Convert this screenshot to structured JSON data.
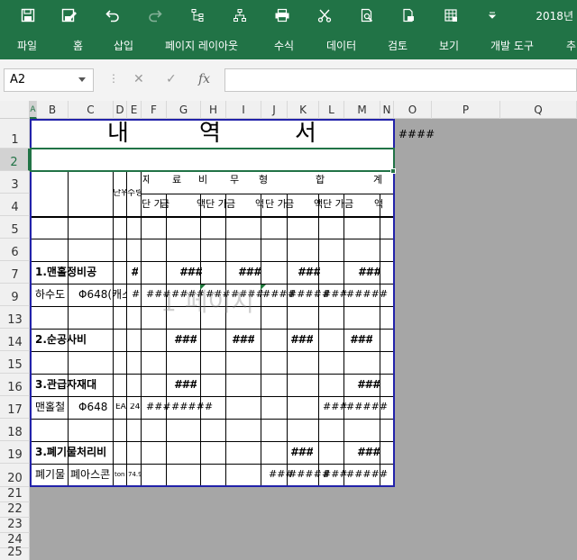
{
  "app": {
    "document_title": "2018년"
  },
  "qat": {
    "items": [
      "save-icon",
      "save-as-icon",
      "undo-icon",
      "redo-icon",
      "org-chart-icon",
      "hierarchy-icon",
      "print-icon",
      "scissors-icon",
      "print-preview-icon",
      "document-export-icon",
      "page-setup-icon",
      "customize-dropdown-icon"
    ]
  },
  "ribbon": {
    "tabs": [
      "파일",
      "홈",
      "삽입",
      "페이지 레이아웃",
      "수식",
      "데이터",
      "검토",
      "보기",
      "개발 도구",
      "추"
    ]
  },
  "formula_bar": {
    "name_box": "A2",
    "cancel": "✕",
    "enter": "✓",
    "fx": "fx",
    "content": ""
  },
  "columns": [
    "A",
    "B",
    "C",
    "D",
    "E",
    "F",
    "G",
    "H",
    "I",
    "J",
    "K",
    "L",
    "M",
    "N",
    "O",
    "P",
    "Q"
  ],
  "rows": [
    "1",
    "2",
    "3",
    "4",
    "5",
    "6",
    "7",
    "9",
    "13",
    "14",
    "15",
    "16",
    "17",
    "18",
    "19",
    "20",
    "21",
    "22",
    "23",
    "24",
    "25"
  ],
  "sheet": {
    "title_chars": [
      "내",
      "역",
      "서"
    ],
    "overflow_o1": "####",
    "header3": {
      "unit": "단위",
      "qty": "수량",
      "chars": [
        "재",
        "료",
        "비",
        "무",
        "형",
        "합",
        "계"
      ]
    },
    "header4": [
      "단 가",
      "금",
      "액",
      "단 가",
      "금",
      "액",
      "단 가",
      "금",
      "액",
      "단 가",
      "금",
      "액"
    ],
    "section1": {
      "label": "1.맨홀정비공",
      "e": "#",
      "g": "###",
      "i": "###",
      "k": "###",
      "m": "###"
    },
    "row9": {
      "b": "하수도",
      "c": "Φ648(캐스트",
      "e": "#",
      "f": "###",
      "g": "####",
      "h": "###",
      "i": "####",
      "j": "####",
      "k": "#####",
      "l": "###",
      "m": "#####"
    },
    "section2": {
      "label": "2.순공사비",
      "g": "###",
      "i": "###",
      "k": "###",
      "m": "###"
    },
    "section3": {
      "label": "3.관급자재대",
      "g": "###",
      "m": "###"
    },
    "row17": {
      "b": "맨홀철",
      "c": "Φ648",
      "d": "EA",
      "e": "24",
      "f": "###",
      "g": "#####",
      "l": "###",
      "m": "#####"
    },
    "section4": {
      "label": "3.폐기물처리비",
      "k": "###",
      "m": "###"
    },
    "row20": {
      "b": "폐기물",
      "c": "폐아스콘",
      "d": "ton",
      "e": "74.9",
      "j": "###",
      "k": "#####",
      "l": "###",
      "m": "#####"
    },
    "watermark": "1 페이지"
  }
}
